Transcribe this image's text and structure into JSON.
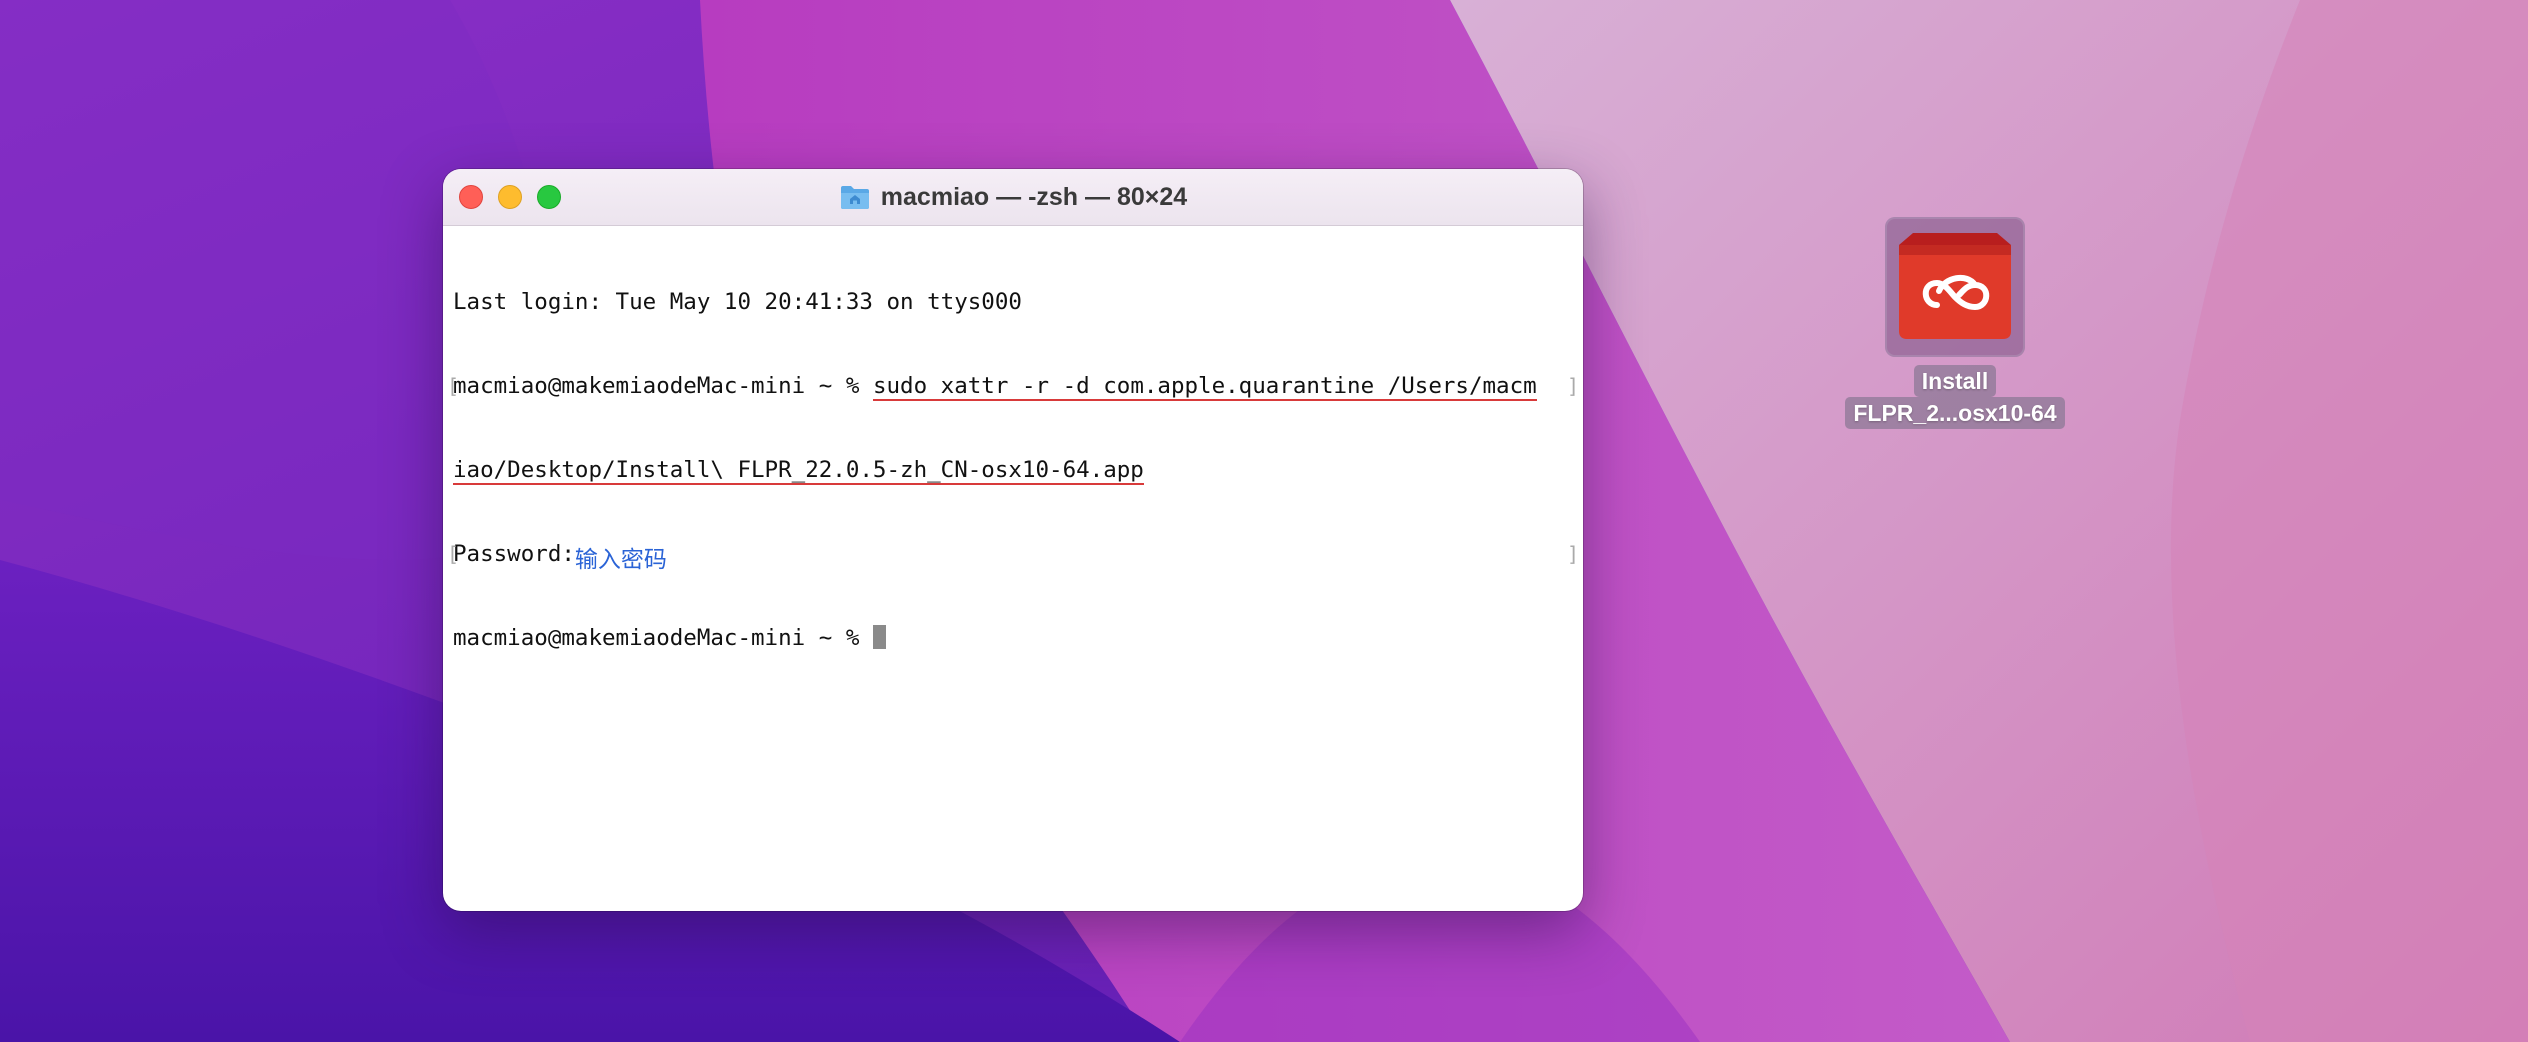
{
  "window": {
    "title": "macmiao — -zsh — 80×24"
  },
  "terminal": {
    "line1": "Last login: Tue May 10 20:41:33 on ttys000",
    "prompt": "macmiao@makemiaodeMac-mini ~ % ",
    "command_part1": "sudo xattr -r -d com.apple.quarantine /Users/macm",
    "command_part2": "iao/Desktop/Install\\ FLPR_22.0.5-zh_CN-osx10-64.app",
    "password_label": "Password:",
    "password_annotation": "输入密码",
    "final_prompt": "macmiao@makemiaodeMac-mini ~ % "
  },
  "desktop_icon": {
    "label_line1": "Install",
    "label_line2": "FLPR_2...osx10-64",
    "icon": "creative-cloud-icon"
  },
  "colors": {
    "annotation": "#2a63d6",
    "underline": "#d83a3a",
    "icon_red": "#e03a2a"
  }
}
